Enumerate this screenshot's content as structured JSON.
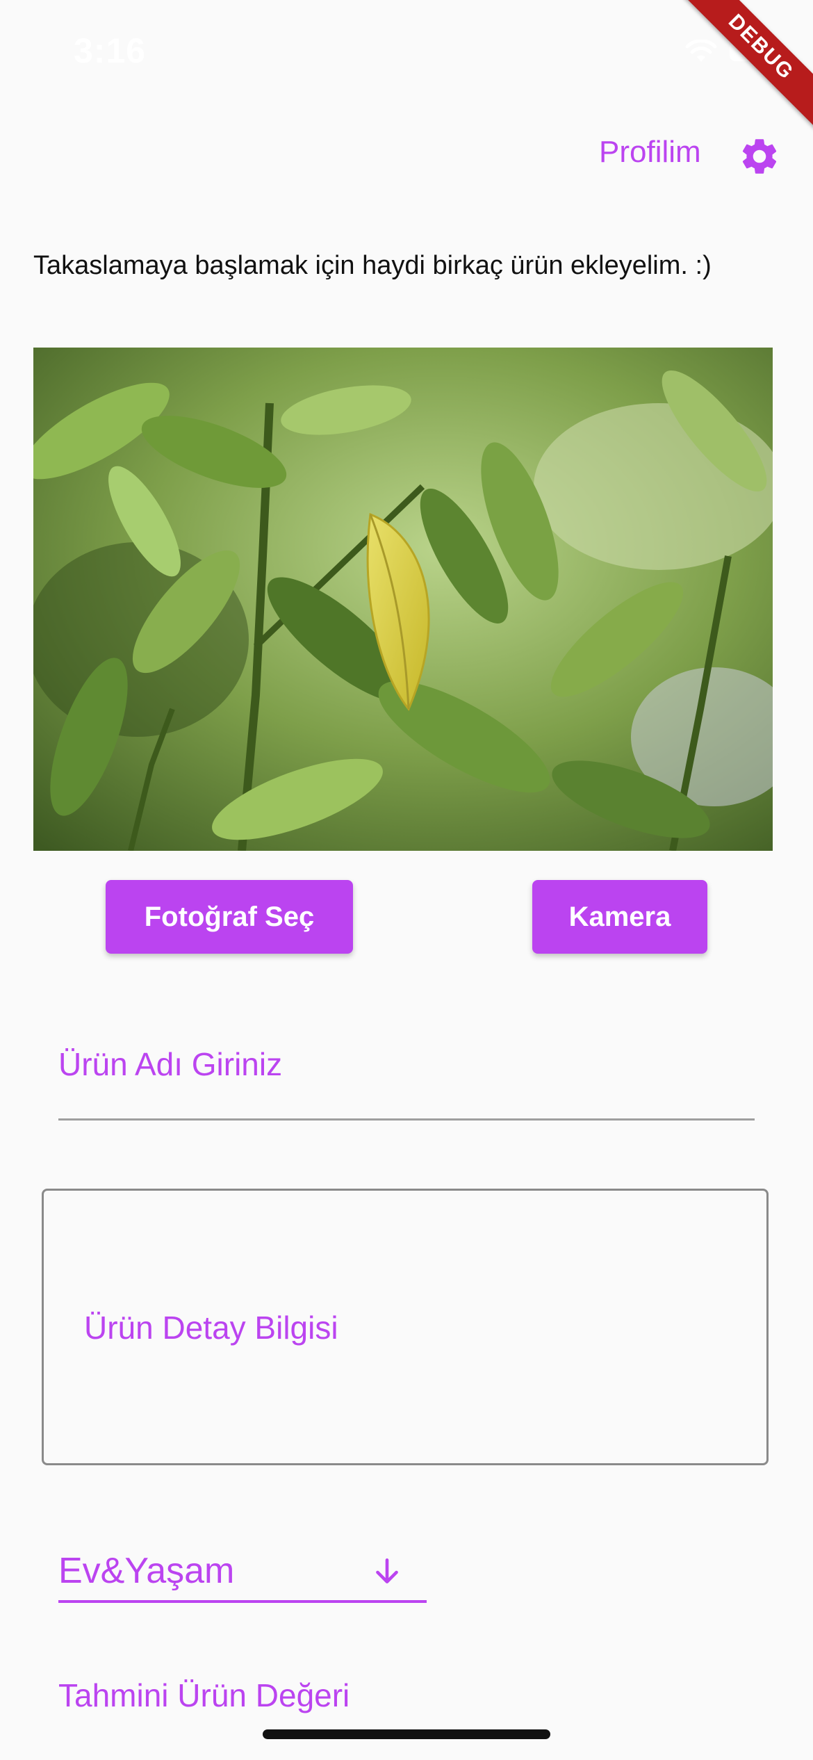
{
  "status_bar": {
    "time": "3:16"
  },
  "debug_banner": {
    "label": "DEBUG"
  },
  "header": {
    "profile_label": "Profilim",
    "settings_icon": "gear-icon"
  },
  "intro": {
    "text": "Takaslamaya başlamak için haydi birkaç ürün ekleyelim. :)"
  },
  "photo": {
    "subject": "green leaves with a yellow leaf"
  },
  "buttons": {
    "gallery_label": "Fotoğraf Seç",
    "camera_label": "Kamera"
  },
  "form": {
    "name_placeholder": "Ürün Adı Giriniz",
    "details_placeholder": "Ürün Detay Bilgisi",
    "category_value": "Ev&Yaşam",
    "category_icon": "arrow-down-icon",
    "value_placeholder": "Tahmini Ürün Değeri"
  },
  "colors": {
    "accent": "#bb44f0",
    "debug_ribbon": "#b71c1c",
    "background": "#fafafa"
  }
}
